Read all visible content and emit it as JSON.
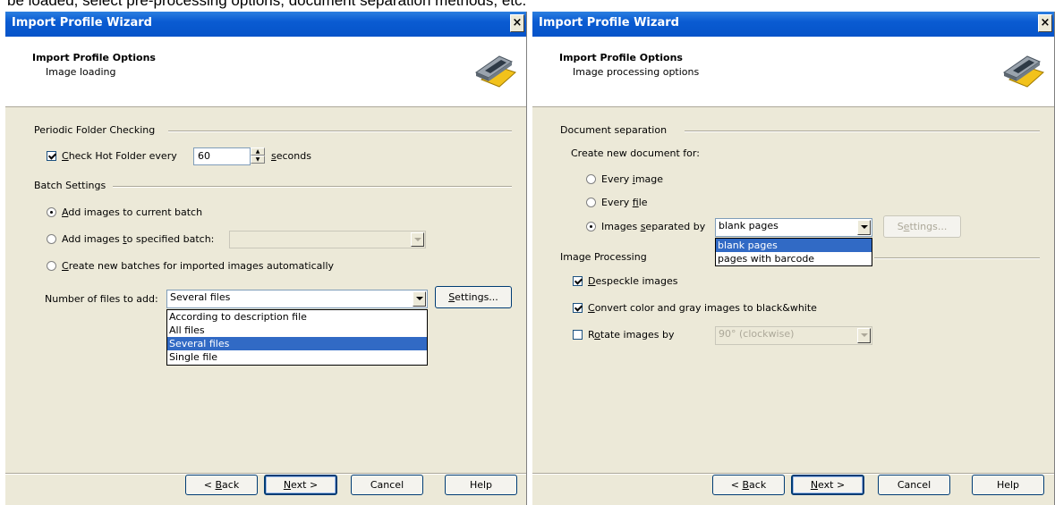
{
  "caption": "be loaded, select pre-processing options, document separation methods, etc.",
  "colors": {
    "titlebar": "#0a5bd2",
    "selection": "#316ac5",
    "dialog_bg": "#ece9d8"
  },
  "left": {
    "title": "Import Profile Wizard",
    "close": "×",
    "header_title": "Import Profile Options",
    "header_sub": "Image loading",
    "periodic_group": "Periodic Folder Checking",
    "check_hot_pre": "Check Hot Folder every",
    "check_hot_u": "C",
    "check_hot_rest": "heck Hot Folder every",
    "interval_value": "60",
    "seconds_u": "s",
    "seconds_rest": "econds",
    "batch_group": "Batch Settings",
    "radio1_u": "A",
    "radio1_rest": "dd images to current batch",
    "radio2_a": "Add images ",
    "radio2_u": "t",
    "radio2_b": "o specified batch:",
    "radio3_u": "C",
    "radio3_rest": "reate new batches for imported images automatically",
    "files_label": "Number of files to add:",
    "files_value": "Several files",
    "settings_u": "S",
    "settings_rest": "ettings...",
    "files_options": [
      "According to description file",
      "All files",
      "Several files",
      "Single file"
    ],
    "back_u": "B",
    "back_pre": "< ",
    "back_rest": "ack",
    "next_u": "N",
    "next_rest": "ext >",
    "cancel": "Cancel",
    "help": "Help"
  },
  "right": {
    "title": "Import Profile Wizard",
    "close": "×",
    "header_title": "Import Profile Options",
    "header_sub": "Image processing options",
    "docsep_group": "Document separation",
    "create_label": "Create new document for:",
    "every_image_a": "Every ",
    "every_image_u": "i",
    "every_image_b": "mage",
    "every_file_a": "Every ",
    "every_file_u": "f",
    "every_file_b": "ile",
    "sep_a": "Images ",
    "sep_u": "s",
    "sep_b": "eparated by",
    "sep_value": "blank pages",
    "sep_options": [
      "blank pages",
      "pages with barcode"
    ],
    "settings_u": "e",
    "settings_a": "S",
    "settings_b": "ttings...",
    "imgproc_group": "Image Processing",
    "despeckle_u": "D",
    "despeckle_rest": "especkle images",
    "convert_u": "C",
    "convert_rest": "onvert color and gray images to black&white",
    "rotate_a": "R",
    "rotate_u": "o",
    "rotate_b": "tate images by",
    "rotate_value": "90° (clockwise)",
    "back_pre": "< ",
    "back_u": "B",
    "back_rest": "ack",
    "next_u": "N",
    "next_rest": "ext >",
    "cancel": "Cancel",
    "help": "Help"
  }
}
